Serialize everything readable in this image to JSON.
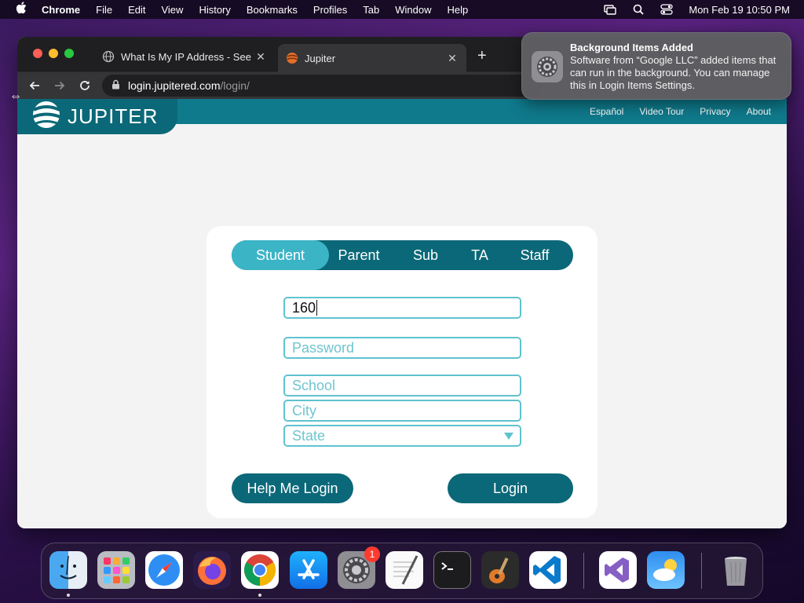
{
  "menubar": {
    "app_name": "Chrome",
    "menus": [
      "File",
      "Edit",
      "View",
      "History",
      "Bookmarks",
      "Profiles",
      "Tab",
      "Window",
      "Help"
    ],
    "datetime": "Mon Feb 19  10:50 PM"
  },
  "browser": {
    "tabs": [
      {
        "title": "What Is My IP Address - See Yo",
        "favicon": "globe-icon",
        "active": false
      },
      {
        "title": "Jupiter",
        "favicon": "jupiter-favicon",
        "active": true
      }
    ],
    "url_host": "login.jupitered.com",
    "url_path": "/login/"
  },
  "site": {
    "logo_text": "JUPITER",
    "nav": [
      "Español",
      "Video Tour",
      "Privacy",
      "About"
    ],
    "roles": [
      "Student",
      "Parent",
      "Sub",
      "TA",
      "Staff"
    ],
    "selected_role": "Student",
    "form": {
      "id_value": "160",
      "password_placeholder": "Password",
      "school_placeholder": "School",
      "city_placeholder": "City",
      "state_placeholder": "State"
    },
    "help_label": "Help Me Login",
    "login_label": "Login"
  },
  "notification": {
    "title": "Background Items Added",
    "body": "Software from “Google LLC” added items that can run in the background. You can manage this in Login Items Settings.",
    "icon": "system-settings-gear-icon"
  },
  "dock": {
    "apps": [
      "Finder",
      "Launchpad",
      "Safari",
      "Firefox",
      "Google Chrome",
      "App Store",
      "System Settings",
      "TextEdit",
      "Terminal",
      "GarageBand",
      "Visual Studio Code",
      "Visual Studio",
      "Weather",
      "Trash"
    ],
    "system_settings_badge": "1"
  },
  "colors": {
    "brand_dark": "#0b6878",
    "brand_light": "#3bb4c6",
    "field_border": "#5fc3cf"
  }
}
